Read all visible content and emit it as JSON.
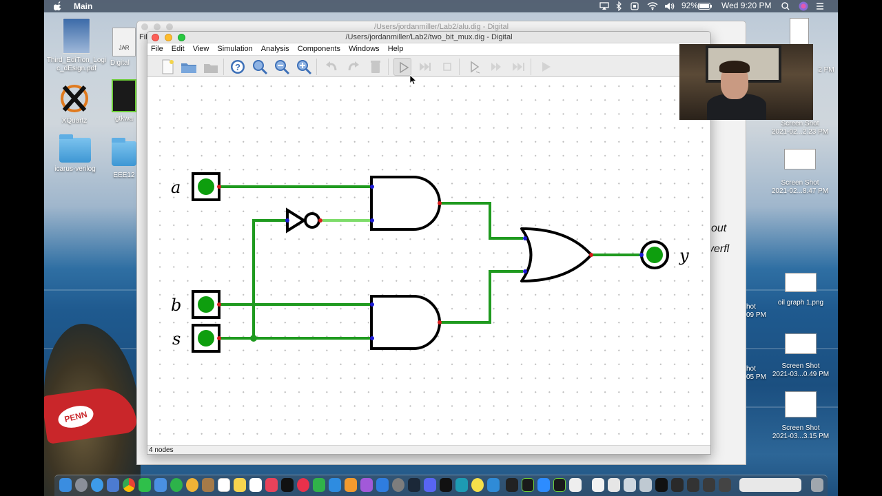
{
  "menubar": {
    "app_name": "Main",
    "battery": "92%",
    "clock": "Wed 9:20 PM"
  },
  "desktop": {
    "left_icons": [
      {
        "label": "Third_EdiTion_Logic_dEsign.pdf"
      },
      {
        "label": "Digital"
      },
      {
        "label": "XQuartz"
      },
      {
        "label": "gtkwa"
      },
      {
        "label": "icarus-verilog"
      },
      {
        "label": "EEE12"
      }
    ],
    "right_icons": [
      {
        "label_line1": "Screen Shot",
        "label_line2": "2021-02...2.23 PM"
      },
      {
        "label_line1": "Screen Shot",
        "label_line2": "2021-02...8.47 PM"
      },
      {
        "label_line1": "oil graph 1.png",
        "label_line2": ""
      },
      {
        "label_line1": "Screen Shot",
        "label_line2": "2021-03...0.49 PM"
      },
      {
        "label_line1": "Screen Shot",
        "label_line2": "2021-03...3.15 PM"
      }
    ],
    "partial_labels": [
      "2 PM",
      "hot",
      "09 PM",
      "hot",
      "05 PM"
    ],
    "photo_cap_text": "PENN"
  },
  "back_window": {
    "title": "/Users/jordanmiller/Lab2/alu.dig - Digital",
    "menu_fragment": "Fil",
    "jar_label": "JAR",
    "text_fragments": [
      "out",
      "verfl"
    ]
  },
  "window": {
    "title": "/Users/jordanmiller/Lab2/two_bit_mux.dig - Digital",
    "menus": [
      "File",
      "Edit",
      "View",
      "Simulation",
      "Analysis",
      "Components",
      "Windows",
      "Help"
    ],
    "status_text": "4 nodes"
  },
  "toolbar": {
    "buttons": [
      "new-file",
      "open",
      "open-recent",
      "help",
      "zoom-fit",
      "zoom-out",
      "zoom-in",
      "undo",
      "redo",
      "delete",
      "start-simulation",
      "run-to-break",
      "stop-simulation",
      "step",
      "fast-run",
      "fast-run-2",
      "analyse"
    ]
  },
  "circuit": {
    "inputs": [
      {
        "label": "a",
        "state": "high"
      },
      {
        "label": "b",
        "state": "high"
      },
      {
        "label": "s",
        "state": "high"
      }
    ],
    "output": {
      "label": "y",
      "state": "high"
    },
    "gates": [
      "AND",
      "AND",
      "NOT",
      "OR"
    ],
    "colors": {
      "wire_high": "#1f9a1f",
      "wire_low": "#7edc6a",
      "pin_high": "#0e9e0e",
      "input_port": "#1b1bd6",
      "output_port": "#d61b1b"
    }
  }
}
